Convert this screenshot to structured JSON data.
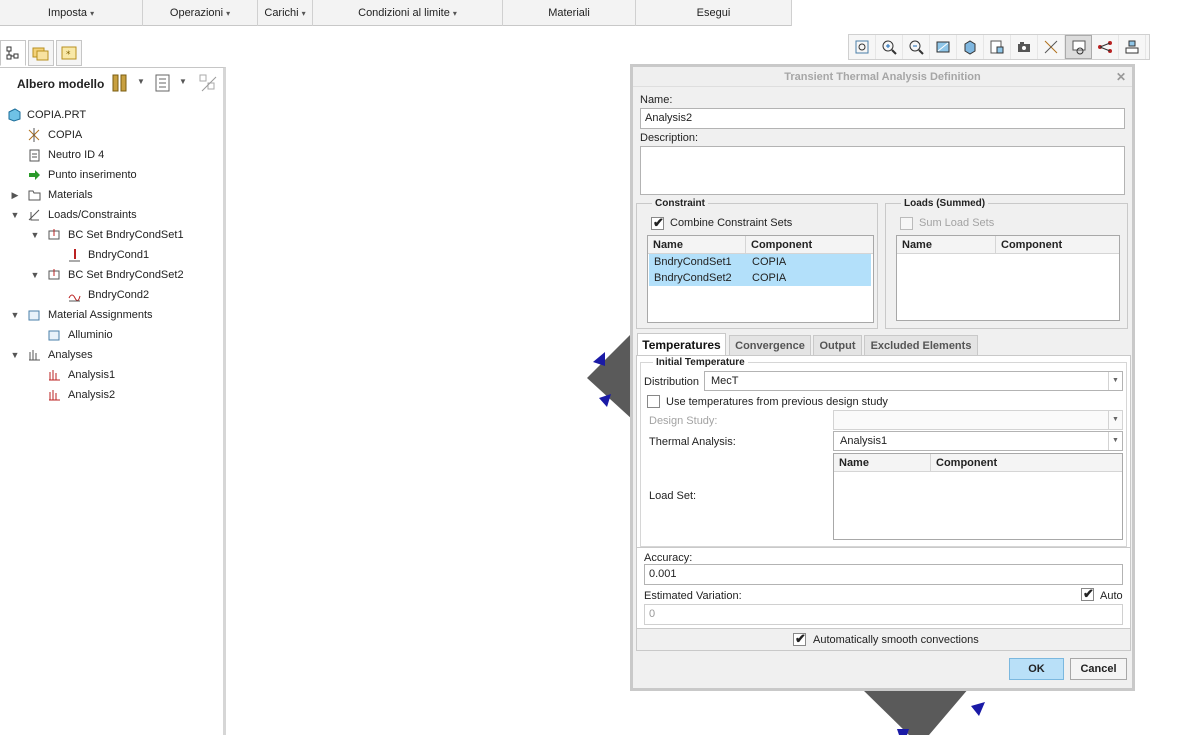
{
  "ribbon": {
    "tabs": [
      {
        "label": "Imposta",
        "caret": "▾"
      },
      {
        "label": "Operazioni",
        "caret": "▾"
      },
      {
        "label": "Carichi",
        "caret": "▾"
      },
      {
        "label": "Condizioni al limite",
        "caret": "▾"
      },
      {
        "label": "Materiali",
        "caret": ""
      },
      {
        "label": "Esegui",
        "caret": ""
      }
    ]
  },
  "tree": {
    "title": "Albero modello",
    "items": [
      {
        "label": "COPIA.PRT",
        "icon": "part-icon"
      },
      {
        "label": "COPIA",
        "icon": "coordinate-system-icon"
      },
      {
        "label": "Neutro ID 4",
        "icon": "feature-icon"
      },
      {
        "label": "Punto inserimento",
        "icon": "insert-point-arrow-icon"
      },
      {
        "label": "Materials",
        "icon": "materials-folder-icon"
      },
      {
        "label": "Loads/Constraints",
        "icon": "loads-constraints-icon"
      },
      {
        "label": "BC Set BndryCondSet1",
        "icon": "bc-set-icon"
      },
      {
        "label": "BndryCond1",
        "icon": "boundary-condition-icon"
      },
      {
        "label": "BC Set BndryCondSet2",
        "icon": "bc-set-icon"
      },
      {
        "label": "BndryCond2",
        "icon": "convection-condition-icon"
      },
      {
        "label": "Material Assignments",
        "icon": "material-assignment-folder-icon"
      },
      {
        "label": "Alluminio",
        "icon": "material-assignment-icon"
      },
      {
        "label": "Analyses",
        "icon": "analyses-folder-icon"
      },
      {
        "label": "Analysis1",
        "icon": "analysis-icon"
      },
      {
        "label": "Analysis2",
        "icon": "analysis-icon"
      }
    ]
  },
  "dialog": {
    "title": "Transient Thermal Analysis Definition",
    "close": "✕",
    "name_label": "Name:",
    "name_value": "Analysis2",
    "description_label": "Description:",
    "description_value": "",
    "constraint": {
      "title": "Constraint",
      "combine_label": "Combine Constraint Sets",
      "combine_checked": "✔",
      "columns": [
        "Name",
        "Component"
      ],
      "rows": [
        {
          "name": "BndryCondSet1",
          "component": "COPIA"
        },
        {
          "name": "BndryCondSet2",
          "component": "COPIA"
        }
      ]
    },
    "loads": {
      "title": "Loads (Summed)",
      "sum_label": "Sum Load Sets",
      "columns": [
        "Name",
        "Component"
      ]
    },
    "tabs": [
      "Temperatures",
      "Convergence",
      "Output",
      "Excluded Elements"
    ],
    "initial_temperature": {
      "title": "Initial Temperature",
      "distribution_label": "Distribution",
      "distribution_value": "MecT",
      "use_prev_label": "Use temperatures from previous design study",
      "design_study_label": "Design Study:",
      "design_study_value": "",
      "thermal_analysis_label": "Thermal Analysis:",
      "thermal_analysis_value": "Analysis1",
      "load_set_label": "Load Set:",
      "load_set_columns": [
        "Name",
        "Component"
      ]
    },
    "accuracy_label": "Accuracy:",
    "accuracy_value": "0.001",
    "estimated_variation_label": "Estimated Variation:",
    "estimated_variation_value": "0",
    "auto_label": "Auto",
    "auto_checked": "✔",
    "smooth_label": "Automatically smooth convections",
    "smooth_checked": "✔",
    "ok_label": "OK",
    "cancel_label": "Cancel"
  },
  "colors": {
    "selection": "#b3e0fa",
    "primary_button": "#b9e0f8",
    "model_shape": "#5a5a5a",
    "constraint_marker": "#1a1aa6"
  }
}
